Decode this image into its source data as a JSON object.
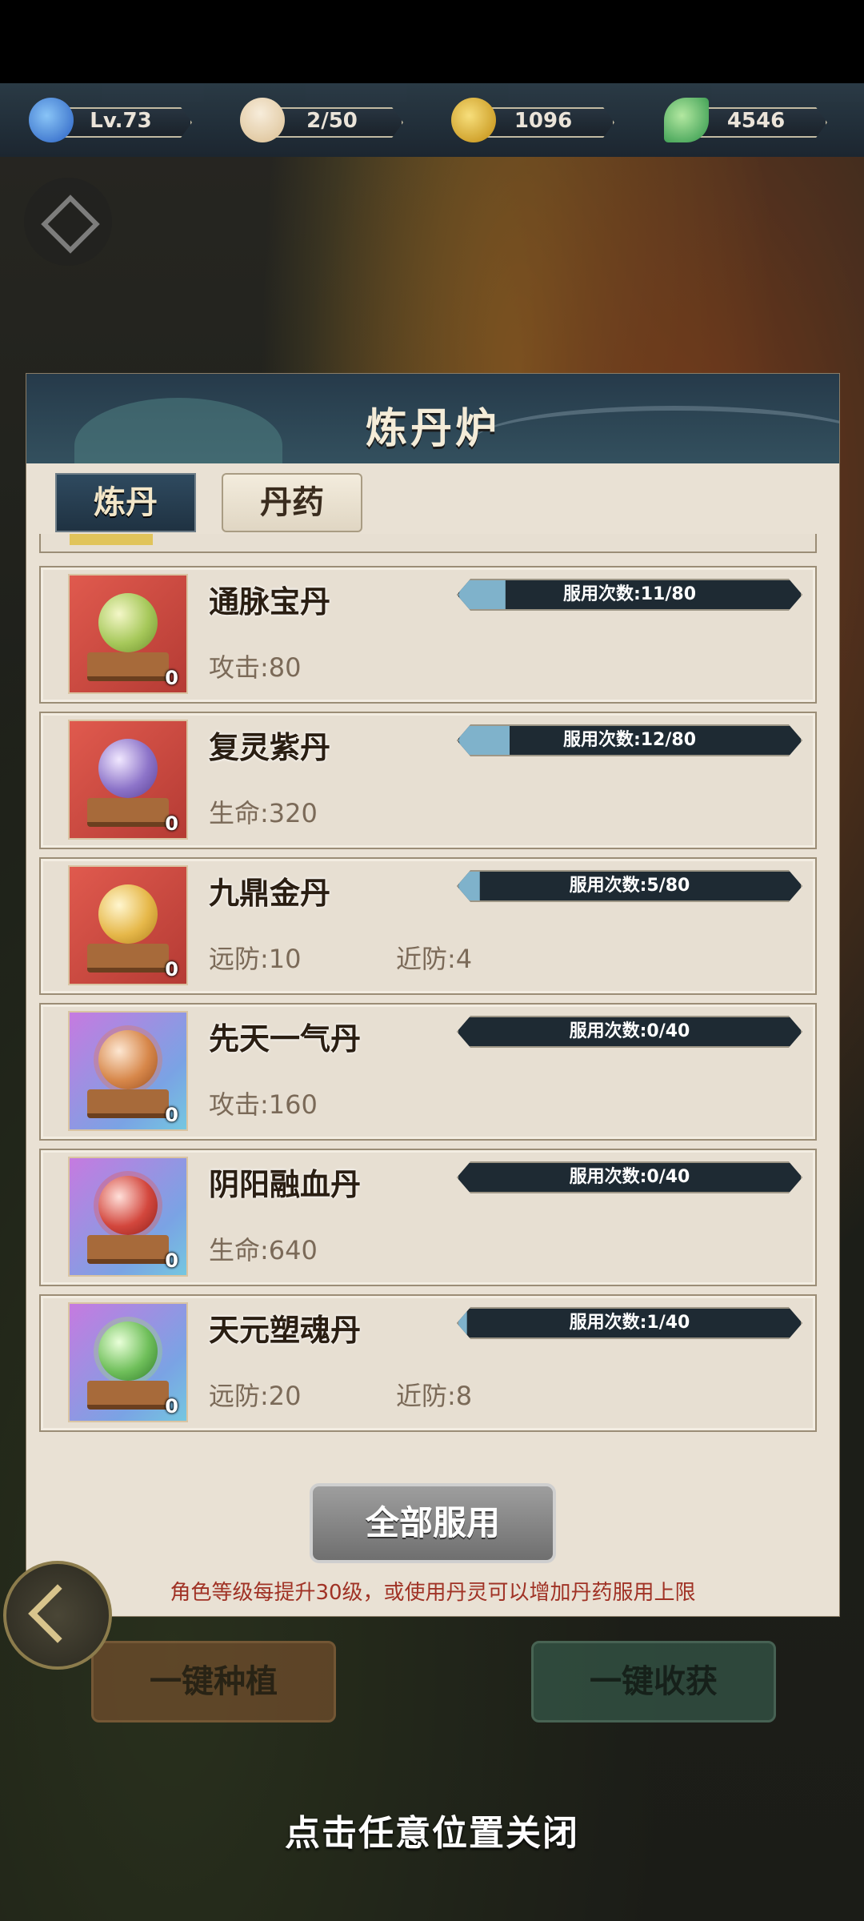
{
  "resources": [
    {
      "icon": "swirl-level-icon",
      "value": "Lv.73",
      "color": "#4a8ee8"
    },
    {
      "icon": "steamed-bun-icon",
      "value": "2/50",
      "color": "#f0d9b0"
    },
    {
      "icon": "gold-coin-icon",
      "value": "1096",
      "color": "#e5b523"
    },
    {
      "icon": "jade-leaf-icon",
      "value": "4546",
      "color": "#5fbf6a"
    }
  ],
  "panel": {
    "title": "炼丹炉",
    "tabs": [
      {
        "label": "炼丹",
        "active": true
      },
      {
        "label": "丹药",
        "active": false
      }
    ]
  },
  "pills": [
    {
      "name": "通脉宝丹",
      "usage_label": "服用次数:11/80",
      "progress": 0.1375,
      "stats": [
        "攻击:80"
      ],
      "count": "0",
      "frame": "red",
      "orb_color": "#a6c85a"
    },
    {
      "name": "复灵紫丹",
      "usage_label": "服用次数:12/80",
      "progress": 0.15,
      "stats": [
        "生命:320"
      ],
      "count": "0",
      "frame": "red",
      "orb_color": "#8d74c9"
    },
    {
      "name": "九鼎金丹",
      "usage_label": "服用次数:5/80",
      "progress": 0.0625,
      "stats": [
        "远防:10",
        "近防:4"
      ],
      "count": "0",
      "frame": "red",
      "orb_color": "#e6b84a"
    },
    {
      "name": "先天一气丹",
      "usage_label": "服用次数:0/40",
      "progress": 0,
      "stats": [
        "攻击:160"
      ],
      "count": "0",
      "frame": "purple",
      "orb_color": "#d7874a"
    },
    {
      "name": "阴阳融血丹",
      "usage_label": "服用次数:0/40",
      "progress": 0,
      "stats": [
        "生命:640"
      ],
      "count": "0",
      "frame": "purple",
      "orb_color": "#d3473d"
    },
    {
      "name": "天元塑魂丹",
      "usage_label": "服用次数:1/40",
      "progress": 0.025,
      "stats": [
        "远防:20",
        "近防:8"
      ],
      "count": "0",
      "frame": "purple",
      "orb_color": "#6fbf5a"
    }
  ],
  "actions": {
    "use_all": "全部服用"
  },
  "note": "角色等级每提升30级，或使用丹灵可以增加丹药服用上限",
  "background_buttons": {
    "plant": "一键种植",
    "harvest": "一键收获"
  },
  "close_hint": "点击任意位置关闭"
}
